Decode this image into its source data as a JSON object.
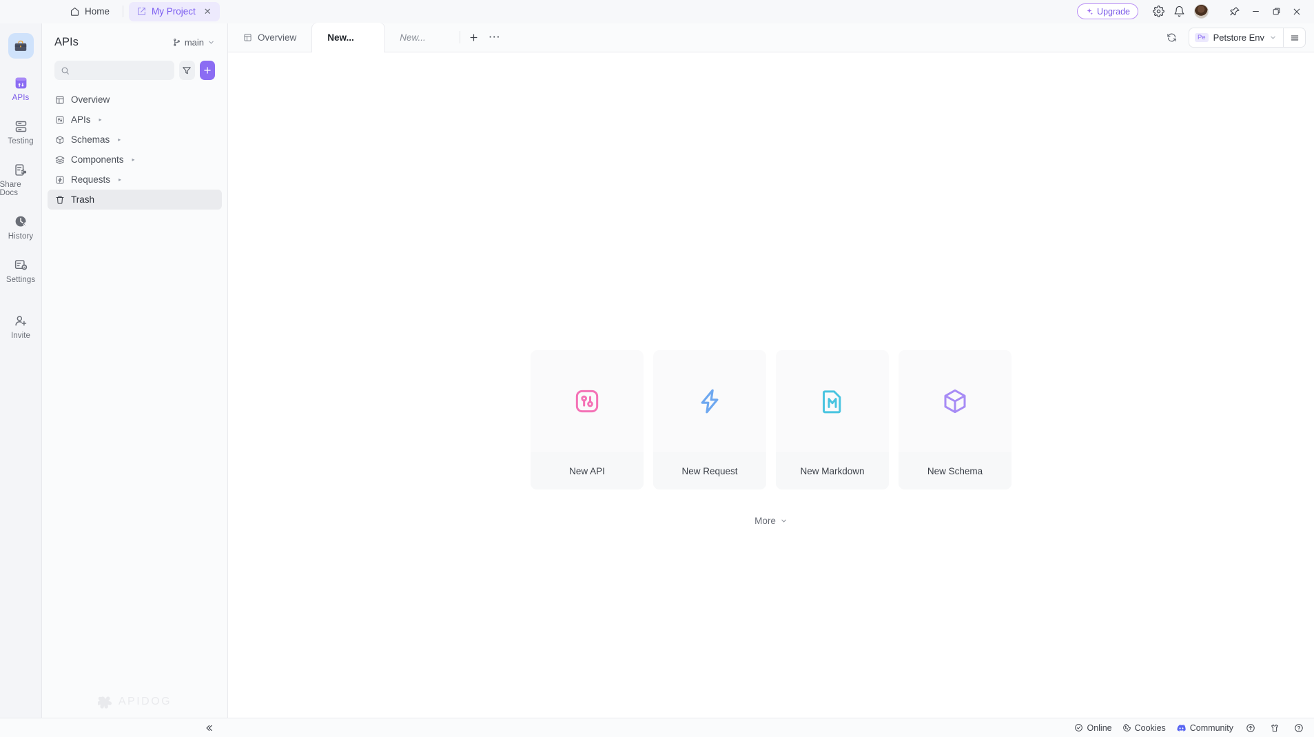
{
  "titlebar": {
    "home_label": "Home",
    "home_icon": "home-icon",
    "project_tab_label": "My Project",
    "project_tab_icon": "project-icon",
    "project_tab_close": "✕",
    "upgrade_label": "Upgrade",
    "upgrade_icon": "sparkle-icon",
    "settings_icon": "gear-icon",
    "notifications_icon": "bell-icon",
    "avatar_icon": "user-avatar",
    "pin_icon": "pin-icon",
    "minimize_icon": "─",
    "maximize_icon": "❐",
    "close_icon": "✕",
    "accent_color": "#7b5ae8"
  },
  "rail": {
    "logo_icon": "briefcase-icon",
    "items": [
      {
        "label": "APIs",
        "icon": "apis-icon",
        "active": true
      },
      {
        "label": "Testing",
        "icon": "testing-icon",
        "active": false
      },
      {
        "label": "Share Docs",
        "icon": "share-docs-icon",
        "active": false
      },
      {
        "label": "History",
        "icon": "history-icon",
        "active": false
      },
      {
        "label": "Settings",
        "icon": "settings-icon",
        "active": false
      },
      {
        "label": "Invite",
        "icon": "invite-icon",
        "active": false
      }
    ]
  },
  "sidebar": {
    "title": "APIs",
    "branch_label": "main",
    "branch_icon": "branch-icon",
    "search_placeholder": "",
    "search_value": "",
    "search_icon": "search-icon",
    "filter_icon": "filter-icon",
    "add_label": "+",
    "tree": [
      {
        "label": "Overview",
        "icon": "overview-icon",
        "expandable": false,
        "selected": false
      },
      {
        "label": "APIs",
        "icon": "apis-folder-icon",
        "expandable": true,
        "selected": false
      },
      {
        "label": "Schemas",
        "icon": "schemas-icon",
        "expandable": true,
        "selected": false
      },
      {
        "label": "Components",
        "icon": "components-icon",
        "expandable": true,
        "selected": false
      },
      {
        "label": "Requests",
        "icon": "requests-icon",
        "expandable": true,
        "selected": false
      },
      {
        "label": "Trash",
        "icon": "trash-icon",
        "expandable": false,
        "selected": true
      }
    ],
    "watermark": "APIDOG"
  },
  "tabbar": {
    "tabs": [
      {
        "label": "Overview",
        "icon": "overview-tab-icon",
        "state": "normal"
      },
      {
        "label": "New...",
        "icon": "",
        "state": "active"
      },
      {
        "label": "New...",
        "icon": "",
        "state": "ghost"
      }
    ],
    "new_tab_label": "+",
    "more_tabs_label": "⋯",
    "refresh_icon": "refresh-icon",
    "env_chip": "Pe",
    "env_label": "Petstore Env",
    "env_chevron": "chevron-down-icon",
    "env_menu_icon": "hamburger-icon"
  },
  "canvas": {
    "cards": [
      {
        "label": "New API",
        "icon": "new-api-icon",
        "color": "#f472b6"
      },
      {
        "label": "New Request",
        "icon": "new-request-icon",
        "color": "#6ea8f0"
      },
      {
        "label": "New Markdown",
        "icon": "new-markdown-icon",
        "color": "#49c4e0"
      },
      {
        "label": "New Schema",
        "icon": "new-schema-icon",
        "color": "#a78bf5"
      }
    ],
    "more_label": "More",
    "more_icon": "chevron-down-icon"
  },
  "statusbar": {
    "collapse_icon": "«",
    "online_label": "Online",
    "online_icon": "check-circle-icon",
    "cookies_label": "Cookies",
    "cookies_icon": "cookie-icon",
    "community_label": "Community",
    "community_icon": "discord-icon",
    "community_color": "#5865f2",
    "upload_icon": "upload-circle-icon",
    "shirt_icon": "shirt-icon",
    "help_icon": "help-circle-icon"
  }
}
